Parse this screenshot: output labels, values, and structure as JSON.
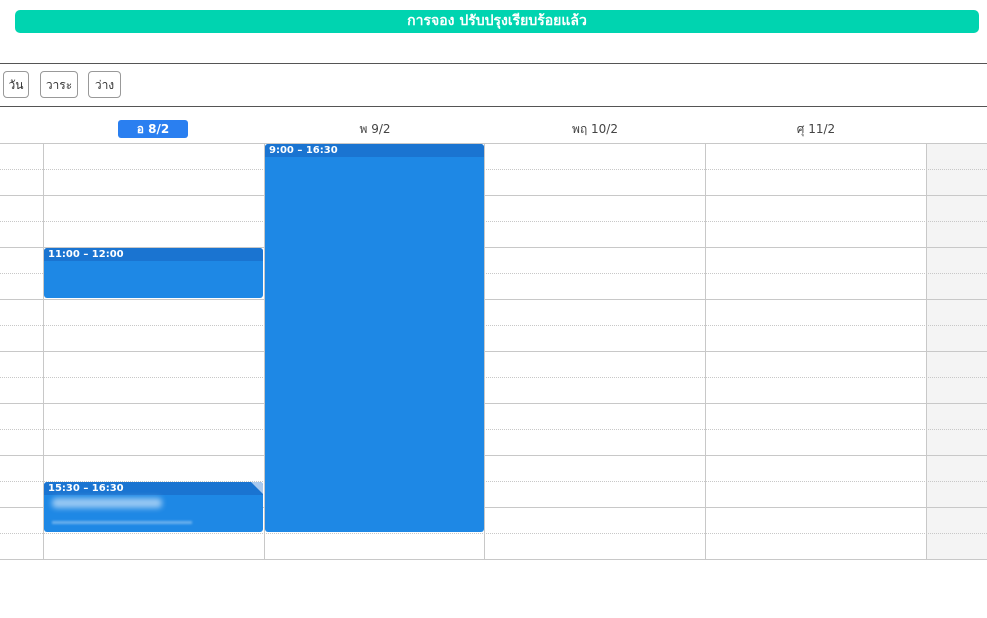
{
  "banner": {
    "text": "การจอง ปรับปรุงเรียบร้อยแล้ว"
  },
  "toolbar": {
    "views": [
      {
        "label": "วัน"
      },
      {
        "label": "วาระ"
      },
      {
        "label": "ว่าง"
      }
    ]
  },
  "days": [
    {
      "label": "อ 8/2",
      "active": true
    },
    {
      "label": "พ 9/2",
      "active": false
    },
    {
      "label": "พฤ 10/2",
      "active": false
    },
    {
      "label": "ศุ 11/2",
      "active": false
    }
  ],
  "events": [
    {
      "time": "11:00 – 12:00",
      "day": "อ 8/2"
    },
    {
      "time": "15:30 – 16:30",
      "day": "อ 8/2",
      "has_hidden_title": true
    },
    {
      "time": "9:00 – 16:30",
      "day": "พ 9/2"
    }
  ],
  "colors": {
    "banner": "#00d4b0",
    "active_day": "#2a7ff0",
    "event": "#1e88e5",
    "event_header": "#1a74d1"
  }
}
